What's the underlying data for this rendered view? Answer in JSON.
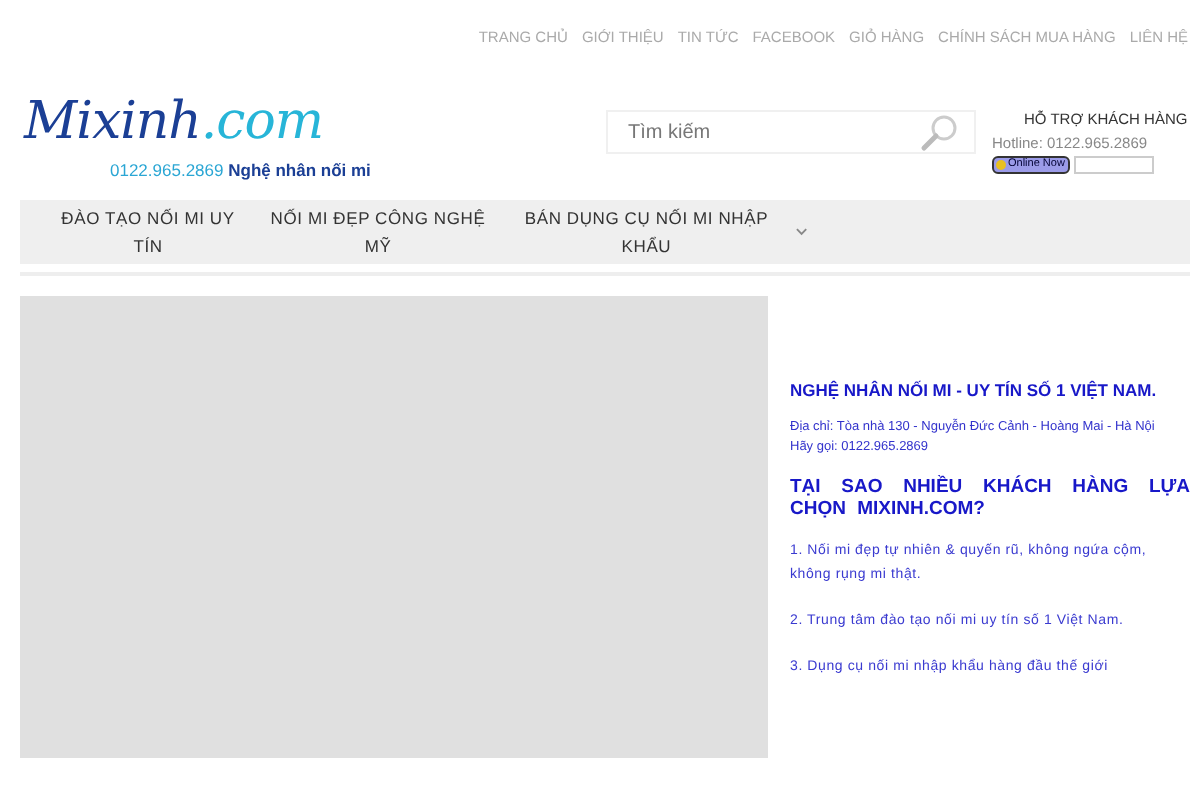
{
  "top_links": [
    "TRANG CHỦ",
    "GIỚI THIỆU",
    "TIN TỨC",
    "FACEBOOK",
    "GIỎ HÀNG",
    "CHÍNH SÁCH MUA HÀNG",
    "LIÊN HỆ"
  ],
  "logo": {
    "name": "Mixinh.com",
    "phone": "0122.965.2869",
    "tagline": "Nghệ nhân nối mi"
  },
  "search": {
    "placeholder": "Tìm kiếm"
  },
  "support": {
    "title": "HỖ TRỢ KHÁCH HÀNG",
    "hotline": "Hotline: 0122.965.2869",
    "badge": "Online Now"
  },
  "nav": [
    {
      "label": "ĐÀO TẠO NỐI MI UY TÍN",
      "has_dropdown": false
    },
    {
      "label": "NỐI MI ĐẸP CÔNG NGHỆ MỸ",
      "has_dropdown": false
    },
    {
      "label": "BÁN DỤNG CỤ NỐI MI NHẬP KHẨU",
      "has_dropdown": true
    }
  ],
  "main": {
    "heading": "NGHỆ NHÂN NỐI MI - UY TÍN SỐ 1 VIỆT NAM.",
    "address": "Địa chỉ: Tòa nhà 130 - Nguyễn Đức Cảnh - Hoàng Mai - Hà Nội",
    "call": "Hãy gọi: 0122.965.2869",
    "question": "TẠI SAO NHIỀU KHÁCH HÀNG LỰA CHỌN MIXINH.COM?",
    "reasons": [
      "1. Nối mi đẹp tự nhiên & quyến rũ, không ngứa cộm, không rụng mi thật.",
      "2. Trung tâm đào tạo nối mi uy tín số 1 Việt Nam.",
      "3. Dụng cụ nối mi nhập khẩu hàng đầu thế giới"
    ]
  }
}
